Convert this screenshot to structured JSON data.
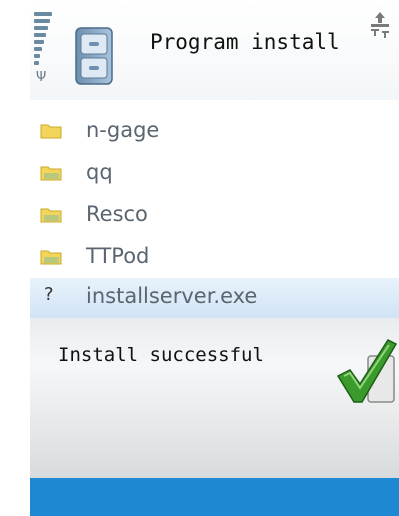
{
  "header": {
    "title": "Program install",
    "icons": {
      "signal": "signal-strength-icon",
      "app": "file-cabinet-icon",
      "connection": "connection-icon"
    }
  },
  "list": {
    "items": [
      {
        "label": "n-gage",
        "icon": "folder-icon"
      },
      {
        "label": "qq",
        "icon": "folder-icon"
      },
      {
        "label": "Resco",
        "icon": "folder-icon"
      },
      {
        "label": "TTPod",
        "icon": "folder-icon"
      },
      {
        "label": "installserver.exe",
        "icon": "unknown-file-icon",
        "icon_text": "?"
      }
    ]
  },
  "notification": {
    "text": "Install successful",
    "icon": "checkmark-icon"
  },
  "colors": {
    "accent": "#1e88d2",
    "list_text": "#5a6570",
    "folder": "#f2d55a"
  }
}
